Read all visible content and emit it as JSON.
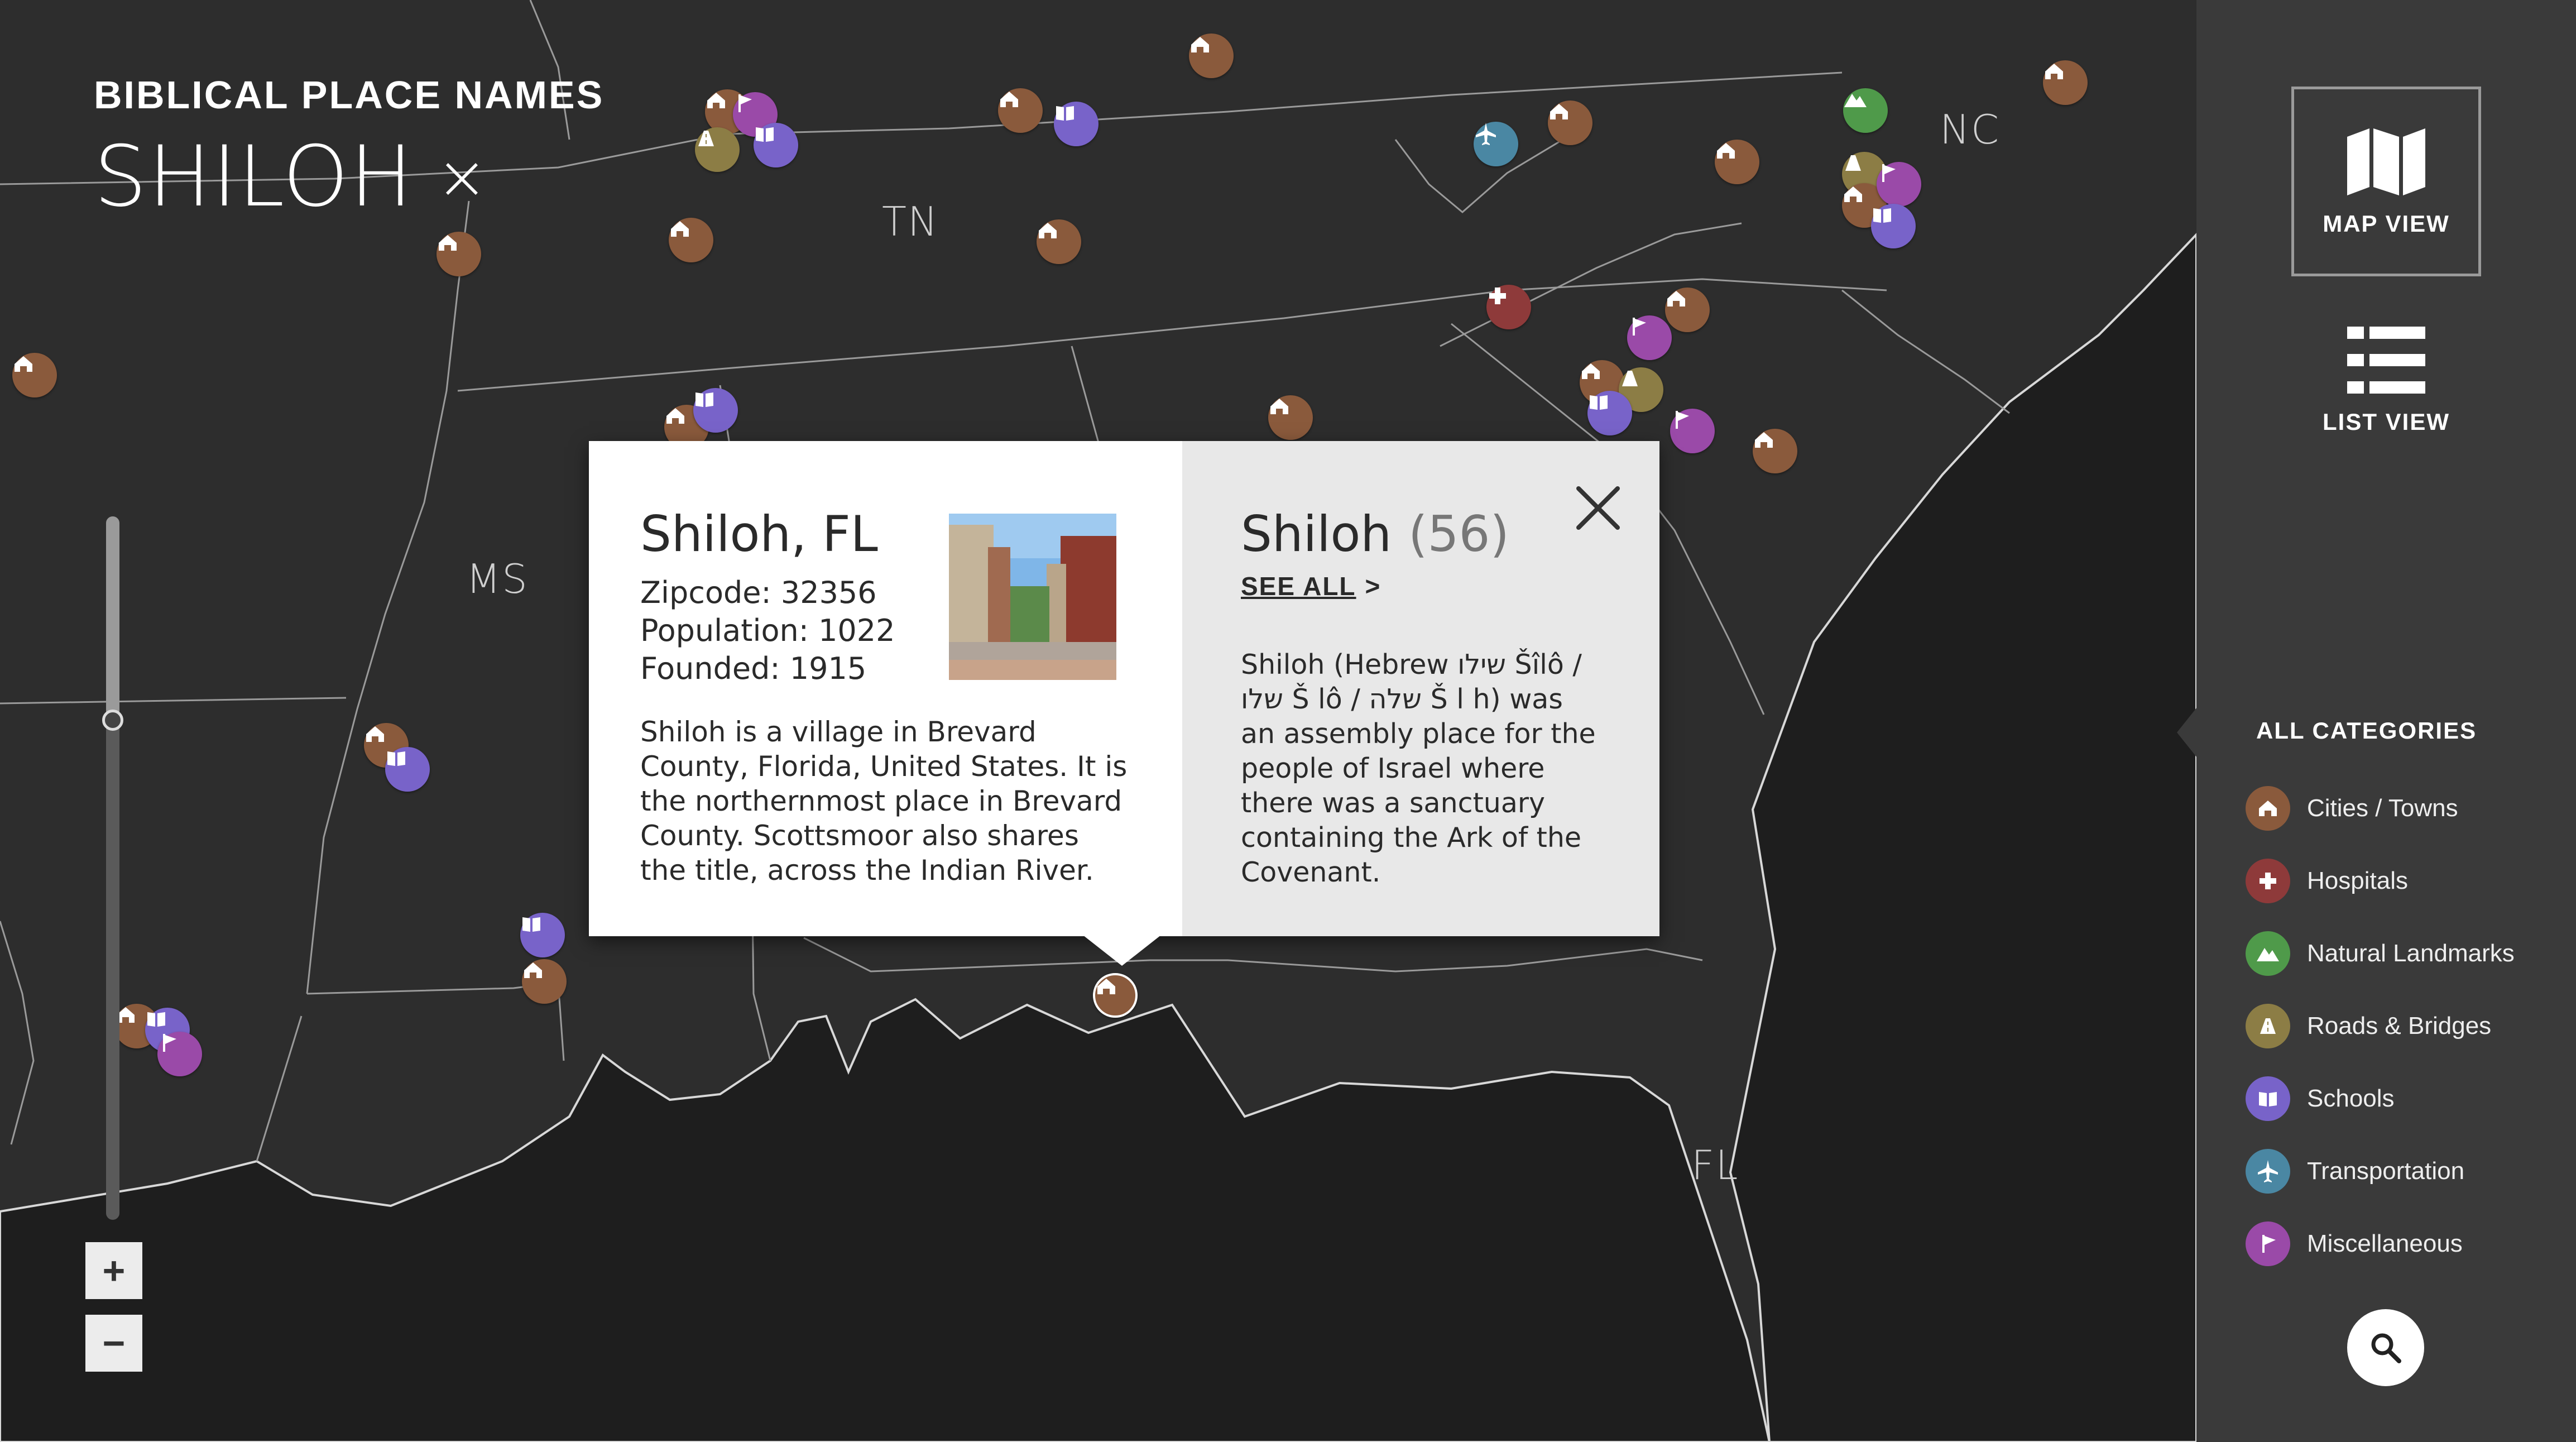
{
  "header": {
    "brand": "BIBLICAL PLACE NAMES",
    "title": "SHILOH",
    "close_glyph": "×"
  },
  "map": {
    "state_labels": {
      "tn": "TN",
      "nc": "NC",
      "ms": "MS",
      "fl": "FL"
    },
    "zoom": {
      "level_fraction": 0.29,
      "plus": "+",
      "minus": "−"
    }
  },
  "popup": {
    "place_name": "Shiloh, FL",
    "zipcode": "Zipcode: 32356",
    "population": "Population: 1022",
    "founded": "Founded: 1915",
    "description": "Shiloh is a village in Brevard County, Florida, United States. It is the northernmost place in Brevard County. Scottsmoor also shares the title, across the Indian River.",
    "name_title": "Shiloh",
    "name_count": "(56)",
    "see_all": "SEE ALL",
    "see_all_arrow": ">",
    "name_description": "Shiloh (Hebrew שילו Šîlô / שלו Š lô / שלה Š l h) was an assembly place for the people of Israel where there was a sanctuary containing the Ark of the Covenant."
  },
  "sidebar": {
    "map_view": "MAP VIEW",
    "list_view": "LIST VIEW",
    "categories_heading": "ALL CATEGORIES",
    "categories": [
      {
        "label": "Cities / Towns",
        "icon": "house-icon",
        "color": "#8a5a3c"
      },
      {
        "label": "Hospitals",
        "icon": "cross-icon",
        "color": "#8e3a3a"
      },
      {
        "label": "Natural Landmarks",
        "icon": "mountain-icon",
        "color": "#4f9a4a"
      },
      {
        "label": "Roads & Bridges",
        "icon": "road-icon",
        "color": "#8c7d45"
      },
      {
        "label": "Schools",
        "icon": "book-icon",
        "color": "#7863c9"
      },
      {
        "label": "Transportation",
        "icon": "plane-icon",
        "color": "#4a87a3"
      },
      {
        "label": "Miscellaneous",
        "icon": "flag-icon",
        "color": "#9a4aa8"
      }
    ]
  }
}
